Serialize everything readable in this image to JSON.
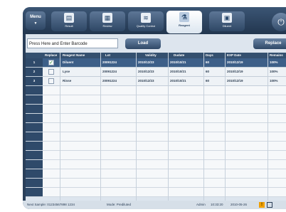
{
  "toolbar": {
    "menu_label": "Menu",
    "tabs": [
      {
        "label": "Result",
        "icon": "result-icon",
        "glyph": "▤"
      },
      {
        "label": "Review",
        "icon": "review-icon",
        "glyph": "▦"
      },
      {
        "label": "Quality Control",
        "icon": "quality-control-icon",
        "glyph": "≋"
      },
      {
        "label": "Reagent",
        "icon": "reagent-icon",
        "glyph": "⚗"
      },
      {
        "label": "Diluent",
        "icon": "diluent-icon",
        "glyph": "▣"
      }
    ],
    "active_tab": "Reagent",
    "power_glyph": "⏻"
  },
  "barcode": {
    "value": "Press Here and Enter Barcode"
  },
  "buttons": {
    "load": "Load",
    "replace": "Replace"
  },
  "table": {
    "columns": [
      "Replace",
      "Reagent Name",
      "Lot",
      "Validity",
      "Dudate",
      "Days",
      "EXP Date",
      "Remains"
    ],
    "rows": [
      {
        "num": "1",
        "checked": true,
        "name": "Diluent",
        "lot": "20091224",
        "validity": "2010/12/23",
        "dudate": "2010/10/21",
        "days": "60",
        "exp": "2010/12/19",
        "remains": "100%"
      },
      {
        "num": "2",
        "checked": false,
        "name": "Lyse",
        "lot": "20091224",
        "validity": "2010/12/23",
        "dudate": "2010/10/21",
        "days": "60",
        "exp": "2010/12/19",
        "remains": "100%"
      },
      {
        "num": "3",
        "checked": false,
        "name": "Rinse",
        "lot": "20091224",
        "validity": "2010/12/23",
        "dudate": "2010/10/21",
        "days": "60",
        "exp": "2010/12/19",
        "remains": "100%"
      }
    ]
  },
  "status": {
    "next_sample": "Next Sample: 01234567898 1234",
    "mode": "Mode: Prediluted",
    "user": "Admin",
    "time": "10:33:20",
    "date": "2010-05-26"
  },
  "colors": {
    "accent": "#2a3f59",
    "selected_row": "#3d5f88",
    "warning": "#f0a000"
  }
}
